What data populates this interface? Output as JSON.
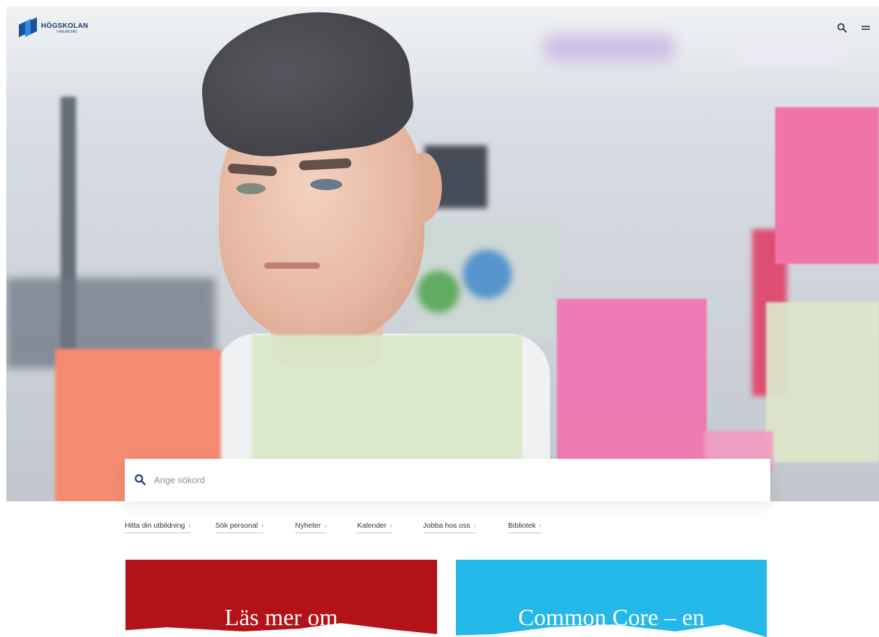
{
  "header": {
    "logo_line1": "HÖGSKOLAN",
    "logo_line2": "I HALMSTAD",
    "search_icon": "search-icon",
    "menu_icon": "hamburger-menu-icon"
  },
  "search": {
    "placeholder": "Ange sökord",
    "icon": "search-icon"
  },
  "quick_links": [
    {
      "label": "Hitta din utbildning"
    },
    {
      "label": "Sök personal"
    },
    {
      "label": "Nyheter"
    },
    {
      "label": "Kalender"
    },
    {
      "label": "Jobba hos oss"
    },
    {
      "label": "Bibliotek"
    }
  ],
  "cards": [
    {
      "title": "Läs mer om",
      "color": "#b31218"
    },
    {
      "title": "Common Core – en",
      "color": "#24b8e8"
    }
  ],
  "colors": {
    "brand": "#1e4f9a",
    "accent": "#2a8fd8",
    "link_underline": "#9ecbe6"
  }
}
